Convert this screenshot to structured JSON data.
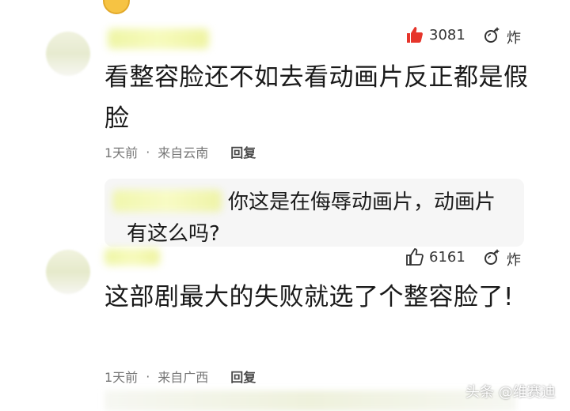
{
  "comment_1": {
    "likes": "3081",
    "reaction_label": "炸",
    "text": "看整容脸还不如去看动画片反正都是假脸",
    "time": "1天前",
    "dot": "·",
    "location": "来自云南",
    "reply_label": "回复"
  },
  "quote": {
    "text": "你这是在侮辱动画片，动画片有这么吗?"
  },
  "comment_2": {
    "likes": "6161",
    "reaction_label": "炸",
    "text": "这部剧最大的失败就选了个整容脸了!",
    "time": "1天前",
    "dot": "·",
    "location": "来自广西",
    "reply_label": "回复"
  },
  "watermark": "头条 @维赛迪",
  "colors": {
    "like_red": "#e6352b",
    "meta_gray": "#777777",
    "quote_bg": "#f6f6f6"
  },
  "icons": {
    "like_active": "thumbs-up-filled-icon",
    "like_inactive": "thumbs-up-outline-icon",
    "reaction": "bomb-icon"
  }
}
